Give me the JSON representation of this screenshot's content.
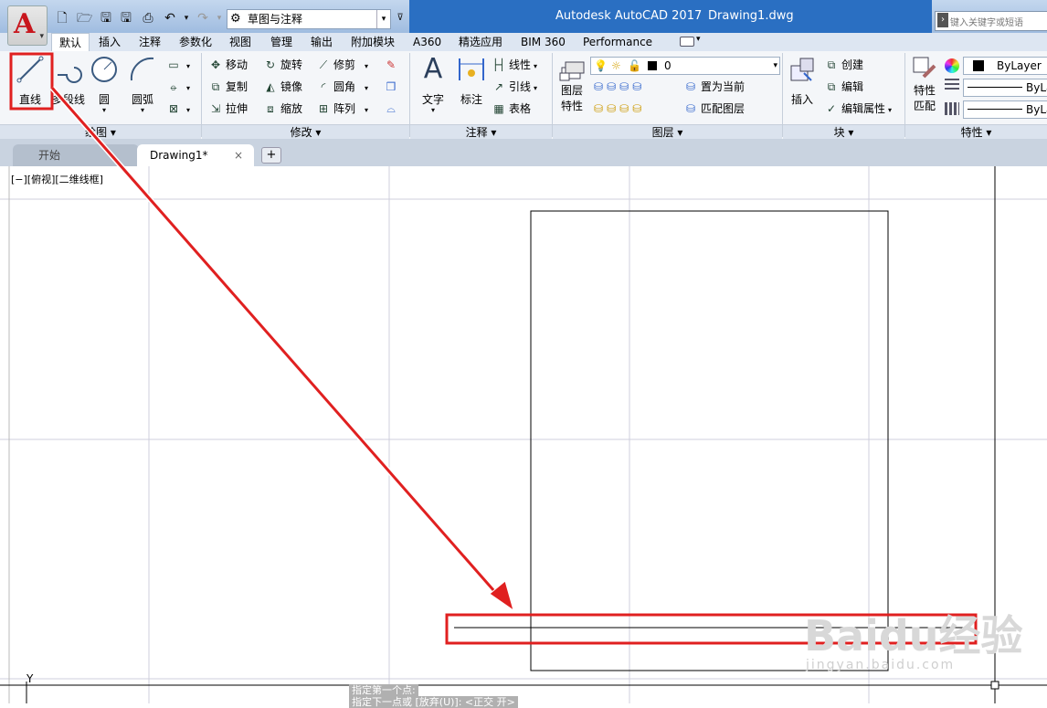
{
  "app": {
    "title": "Autodesk AutoCAD 2017",
    "document": "Drawing1.dwg",
    "logo_letter": "A",
    "workspace": "草图与注释",
    "search_placeholder": "键入关键字或短语"
  },
  "ribbon_tabs": [
    "默认",
    "插入",
    "注释",
    "参数化",
    "视图",
    "管理",
    "输出",
    "附加模块",
    "A360",
    "精选应用",
    "BIM 360",
    "Performance"
  ],
  "draw_panel": {
    "title": "绘图",
    "line": "直线",
    "polyline": "多段线",
    "circle": "圆",
    "arc": "圆弧"
  },
  "modify_panel": {
    "title": "修改",
    "move": "移动",
    "rotate": "旋转",
    "trim": "修剪",
    "copy": "复制",
    "mirror": "镜像",
    "fillet": "圆角",
    "stretch": "拉伸",
    "scale": "缩放",
    "array": "阵列"
  },
  "annotation_panel": {
    "title": "注释",
    "text": "文字",
    "dimension": "标注",
    "linear": "线性",
    "leader": "引线",
    "table": "表格"
  },
  "layers_panel": {
    "title": "图层",
    "layer_properties_1": "图层",
    "layer_properties_2": "特性",
    "current_layer": "0",
    "set_current": "置为当前",
    "match_layer": "匹配图层"
  },
  "block_panel": {
    "title": "块",
    "insert": "插入",
    "create": "创建",
    "edit": "编辑",
    "edit_attributes": "编辑属性"
  },
  "properties_panel": {
    "title": "特性",
    "match_1": "特性",
    "match_2": "匹配",
    "color": "ByLayer",
    "linetype": "ByLa",
    "lineweight": "ByLa"
  },
  "doc_tabs": {
    "start": "开始",
    "drawing": "Drawing1*",
    "close": "×",
    "add": "+"
  },
  "viewport_label": "[−][俯视][二维线框]",
  "command_line": {
    "line1": "指定第一个点:",
    "line2": "指定下一点或 [放弃(U)]:  <正交 开>"
  },
  "ucs_label": "Y",
  "watermark": {
    "main": "Baidu经验",
    "sub": "jingyan.baidu.com"
  },
  "colors": {
    "highlight": "#e02020",
    "title_bar": "#2a6fc2",
    "grid": "#c8c8d4"
  }
}
